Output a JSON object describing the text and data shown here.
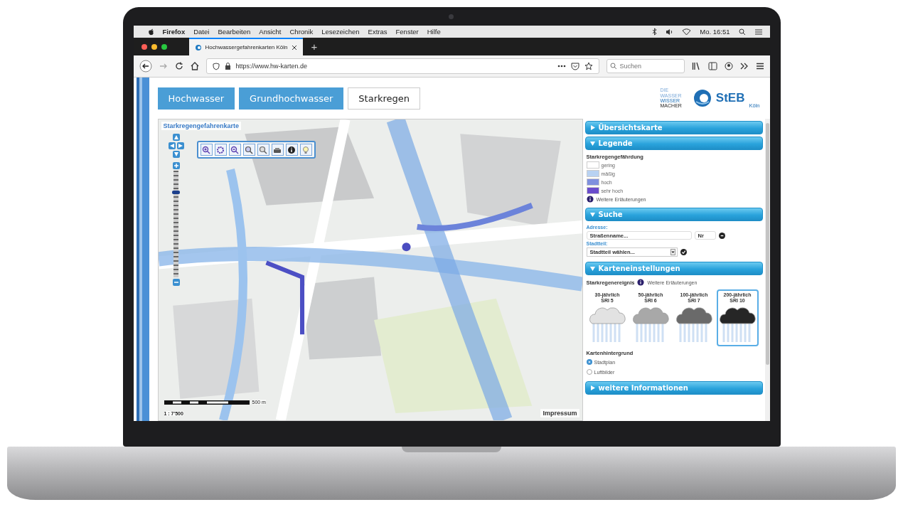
{
  "menu_bar": {
    "items": [
      "Firefox",
      "Datei",
      "Bearbeiten",
      "Ansicht",
      "Chronik",
      "Lesezeichen",
      "Extras",
      "Fenster",
      "Hilfe"
    ],
    "clock": "Mo. 16:51"
  },
  "browser": {
    "tab": {
      "title": "Hochwassergefahrenkarten Köln",
      "selected": true
    },
    "new_tab": "+",
    "url": "https://www.hw-karten.de",
    "search": {
      "placeholder": "Suchen"
    }
  },
  "nav_tabs": [
    {
      "label": "Hochwasser",
      "selected": false
    },
    {
      "label": "Grundhochwasser",
      "selected": false
    },
    {
      "label": "Starkregen",
      "selected": true
    }
  ],
  "logo": {
    "tagline": [
      "DIE",
      "WASSER",
      "WISSER",
      "MACHER"
    ],
    "name": "StEB",
    "city": "Köln"
  },
  "map": {
    "title": "Starkregengefahrenkarte",
    "zoom": {
      "level": 0.78
    },
    "scale": "500 m",
    "ratio": "1 : 7'500",
    "impressum": "Impressum"
  },
  "panel": {
    "sections": [
      {
        "kind": "overview",
        "title": "Übersichtskarte",
        "expanded": false
      },
      {
        "kind": "legend",
        "title": "Legende",
        "expanded": true,
        "heading": "Starkregengefährdung",
        "items": [
          {
            "label": "gering",
            "color": "#ffffff"
          },
          {
            "label": "mäßig",
            "color": "#b8d2f2"
          },
          {
            "label": "hoch",
            "color": "#7f90de"
          },
          {
            "label": "sehr hoch",
            "color": "#6a4ccc"
          }
        ],
        "link": "Weitere Erläuterungen"
      },
      {
        "kind": "search",
        "title": "Suche",
        "expanded": true,
        "address_label": "Adresse:",
        "street": {
          "placeholder": "Straßenname..."
        },
        "number": {
          "placeholder": "Nr"
        },
        "district_label": "Stadtteil:",
        "district": {
          "value": "Stadtteil wählen..."
        }
      },
      {
        "kind": "settings",
        "title": "Karteneinstellungen",
        "expanded": true,
        "event_label": "Starkregenereignis",
        "link": "Weitere Erläuterungen",
        "events": [
          {
            "line1": "30-jährlich",
            "line2": "SRI 5",
            "color": "#e2e2e2",
            "selected": false
          },
          {
            "line1": "50-jährlich",
            "line2": "SRI 6",
            "color": "#a8a8a8",
            "selected": false
          },
          {
            "line1": "100-jährlich",
            "line2": "SRI 7",
            "color": "#6a6a6a",
            "selected": false
          },
          {
            "line1": "200-jährlich",
            "line2": "SRI 10",
            "color": "#262626",
            "selected": true
          }
        ],
        "background_label": "Kartenhintergrund",
        "backgrounds": [
          {
            "label": "Stadtplan",
            "selected": true
          },
          {
            "label": "Luftbilder",
            "selected": false
          }
        ]
      },
      {
        "kind": "info",
        "title": "weitere Informationen",
        "expanded": false
      }
    ]
  }
}
